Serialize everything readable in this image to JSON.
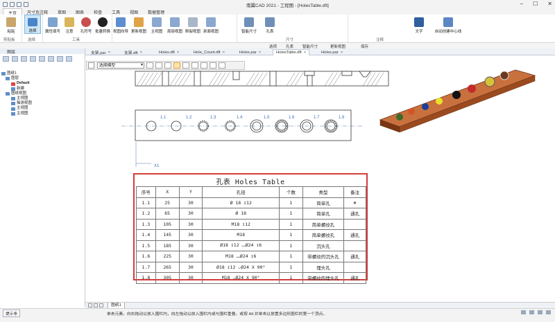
{
  "app": {
    "title": "南翼CAD 2021 - 工程图 - [HolesTable.dft]"
  },
  "menu": [
    "主页",
    "尺寸及注释",
    "草图",
    "图表",
    "检查",
    "工具",
    "视图",
    "数据管理"
  ],
  "ribbon": {
    "buttons": [
      {
        "label": "粘贴",
        "icon": "paste-icon"
      },
      {
        "label": "选择",
        "icon": "select-arrow-icon"
      },
      {
        "label": "属性填写",
        "icon": "property-icon"
      },
      {
        "label": "注意",
        "icon": "note-icon"
      },
      {
        "label": "孔符号",
        "icon": "hole-symbol-icon"
      },
      {
        "label": "批量转换",
        "icon": "batch-convert-icon"
      },
      {
        "label": "视图向导",
        "icon": "view-wizard-icon"
      },
      {
        "label": "更新视图",
        "icon": "update-view-icon"
      },
      {
        "label": "主视图",
        "icon": "principal-view-icon"
      },
      {
        "label": "局部视图",
        "icon": "detail-view-icon"
      },
      {
        "label": "断裂视图",
        "icon": "break-view-icon"
      },
      {
        "label": "剖面视图",
        "icon": "section-view-icon"
      },
      {
        "label": "智能尺寸",
        "icon": "smart-dimension-icon"
      },
      {
        "label": "孔表",
        "icon": "hole-table-icon"
      },
      {
        "label": "文字",
        "icon": "text-icon"
      },
      {
        "label": "自动创建中心线",
        "icon": "auto-centerline-icon"
      }
    ],
    "groups": [
      "剪贴板",
      "选择",
      "工具",
      "尺寸",
      "注释"
    ]
  },
  "subbar": {
    "items": [
      "选项",
      "孔表",
      "智能尺寸",
      "更新视图",
      "保存"
    ]
  },
  "left_panel": {
    "title": "图层",
    "tree": [
      {
        "label": "图纸1",
        "level": 0
      },
      {
        "label": "图层",
        "level": 1
      },
      {
        "label": "Default",
        "level": 2
      },
      {
        "label": "新建",
        "level": 2
      },
      {
        "label": "图纸视图",
        "level": 1
      },
      {
        "label": "主视图",
        "level": 2
      },
      {
        "label": "轴测视图",
        "level": 2
      },
      {
        "label": "主视图",
        "level": 2
      },
      {
        "label": "主视图",
        "level": 2
      }
    ]
  },
  "tabs": [
    {
      "label": "支架.par",
      "active": false
    },
    {
      "label": "支架.dft",
      "active": false
    },
    {
      "label": "Holes.dft",
      "active": false
    },
    {
      "label": "Hole_Count.dft",
      "active": false
    },
    {
      "label": "Holes.par",
      "active": false
    },
    {
      "label": "HolesTable.dft",
      "active": true
    },
    {
      "label": "Holes.par",
      "active": false
    }
  ],
  "filter": {
    "select_value": "选择模型"
  },
  "drawing": {
    "hole_labels": [
      "1.1",
      "1.2",
      "1.3",
      "1.4",
      "1.5",
      "1.6",
      "1.7",
      "1.8"
    ],
    "axis_x": "X1",
    "axis_y": "Y1"
  },
  "holes_table": {
    "title": "孔表 Holes Table",
    "headers": [
      "序号",
      "X",
      "Y",
      "孔径",
      "个数",
      "类型",
      "备注"
    ],
    "rows": [
      [
        "1.1",
        "25",
        "30",
        "Ø 18 ↧12",
        "1",
        "简单孔",
        "⊕"
      ],
      [
        "1.2",
        "65",
        "30",
        "Ø 18",
        "1",
        "简单孔",
        "通孔"
      ],
      [
        "1.3",
        "105",
        "30",
        "M18 ↧12",
        "1",
        "简单螺纹孔",
        ""
      ],
      [
        "1.4",
        "145",
        "30",
        "M18",
        "1",
        "简单螺纹孔",
        "通孔"
      ],
      [
        "1.5",
        "185",
        "30",
        "Ø18 ↧12 ⌴Ø24 ↧6",
        "1",
        "沉头孔",
        ""
      ],
      [
        "1.6",
        "225",
        "30",
        "M18 ⌴Ø24 ↧6",
        "1",
        "带螺纹的沉头孔",
        "通孔"
      ],
      [
        "1.7",
        "265",
        "30",
        "Ø18 ↧12 ⌵Ø24 X 90°",
        "1",
        "埋头孔",
        ""
      ],
      [
        "1.8",
        "305",
        "30",
        "M18 ⌵Ø24 X 90°",
        "1",
        "带螺纹的埋头孔",
        "通孔"
      ]
    ]
  },
  "sheet_tab": "图纸1",
  "status": {
    "tab": "提示条",
    "prompt": "单击元素。向右拖动以放入围栏内，向左拖动以放入围栏内或与围栏重叠。或按 Alt 并单击以放置多边形围栏的第一个顶点。"
  },
  "colors": {
    "accent": "#d23d3a",
    "ribbon_sel": "#cde6f7",
    "model_body": "#b5552b"
  }
}
